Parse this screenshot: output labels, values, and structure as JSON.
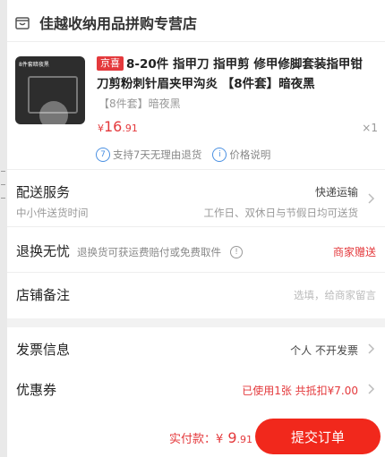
{
  "store": {
    "name": "佳越收纳用品拼购专营店",
    "icon": "store-icon"
  },
  "product": {
    "thumb_tag": "8件套暗夜黑",
    "badge": "京喜",
    "title": "8-20件 指甲刀 指甲剪 修甲修脚套装指甲钳刀剪粉刺针眉夹甲沟炎 【8件套】暗夜黑",
    "spec": "【8件套】暗夜黑",
    "price_currency": "¥",
    "price_int": "16",
    "price_dec": ".91",
    "qty": "×1",
    "service_1": "支持7天无理由退货",
    "service_1_icon": "7",
    "service_2": "价格说明",
    "service_2_icon": "i"
  },
  "delivery": {
    "label": "配送服务",
    "value": "快递运输",
    "sub": "中小件送货时间",
    "sub_value": "工作日、双休日与节假日均可送货"
  },
  "return": {
    "label": "退换无忧",
    "hint": "退换货可获运费赔付或免费取件",
    "value": "商家赠送"
  },
  "remark": {
    "label": "店铺备注",
    "placeholder": "选填，给商家留言"
  },
  "invoice": {
    "label": "发票信息",
    "value": "个人 不开发票"
  },
  "coupon": {
    "label": "优惠券",
    "value": "已使用1张 共抵扣¥7.00"
  },
  "footer": {
    "pay_label": "实付款：",
    "currency": "¥",
    "int": " 9",
    "dec": ".91",
    "submit": "提交订单"
  },
  "colors": {
    "accent": "#e4393c",
    "submit": "#f1281c",
    "info": "#4a90e2"
  }
}
